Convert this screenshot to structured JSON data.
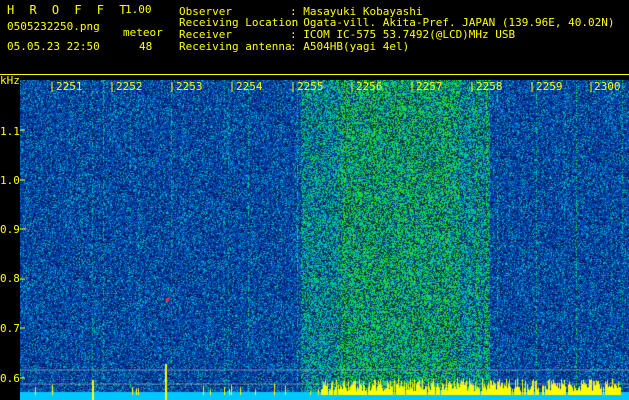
{
  "header": {
    "app_name": "H R O F F T",
    "version": "1.00",
    "filename": "0505232250.png",
    "datetime": "05.05.23 22:50",
    "count_label": "meteor",
    "count_value": "48"
  },
  "info": [
    {
      "label": "Observer",
      "value": ": Masayuki Kobayashi"
    },
    {
      "label": "Receiving Location",
      "value": ": Ogata-vill. Akita-Pref. JAPAN (139.96E, 40.02N)"
    },
    {
      "label": "Receiver",
      "value": ": ICOM IC-575 53.7492(@LCD)MHz USB"
    },
    {
      "label": "Receiving antenna",
      "value": ": A504HB(yagi 4el)"
    }
  ],
  "axes": {
    "y_unit": "kHz",
    "y_ticks": [
      "1.1",
      "1.0",
      "0.9",
      "0.8",
      "0.7",
      "0.6"
    ],
    "x_ticks": [
      "2251",
      "2252",
      "2253",
      "2254",
      "2255",
      "2256",
      "2257",
      "2258",
      "2259",
      "2300"
    ]
  },
  "colors": {
    "text": "#ffff00",
    "background": "#000000",
    "spectrogram_low": "#001a8c",
    "spectrogram_high": "#30ff60",
    "baseline": "#00c8ff"
  }
}
